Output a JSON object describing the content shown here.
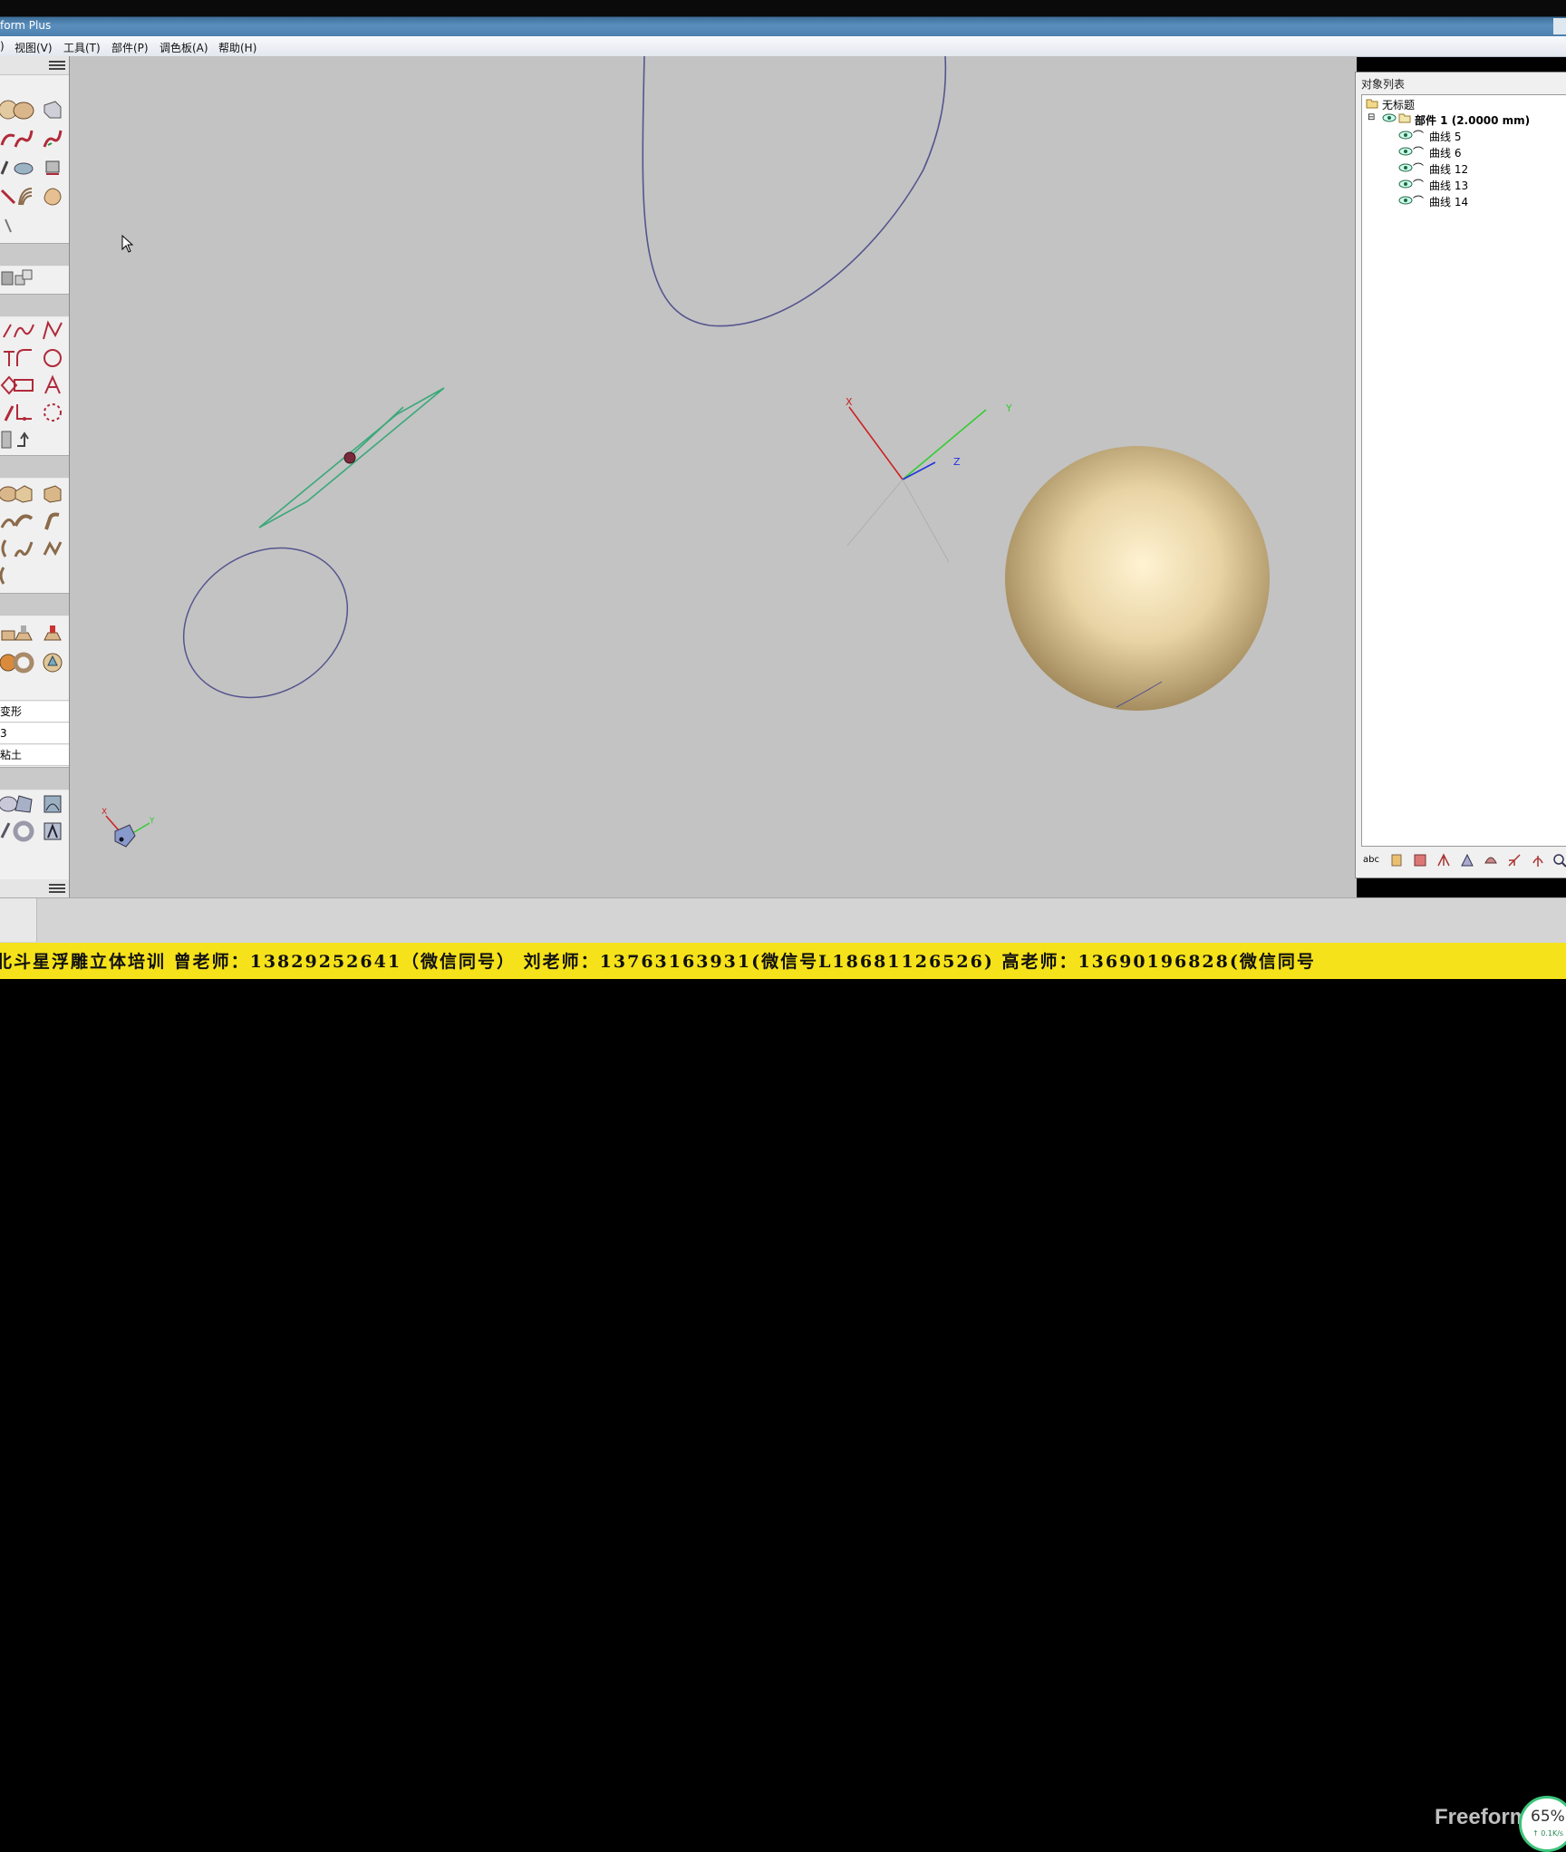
{
  "window": {
    "title": "form Plus"
  },
  "menu": [
    {
      "label": "视图(V)"
    },
    {
      "label": "工具(T)"
    },
    {
      "label": "部件(P)"
    },
    {
      "label": "调色板(A)"
    },
    {
      "label": "帮助(H)"
    }
  ],
  "left_panel": {
    "labels": [
      "变形",
      "3",
      "粘土"
    ]
  },
  "object_list": {
    "title": "对象列表",
    "root": "无标题",
    "part": "部件 1 (2.0000 mm)",
    "curves": [
      "曲线 5",
      "曲线 6",
      "曲线 12",
      "曲线 13",
      "曲线 14"
    ],
    "toolbar_text": "abc"
  },
  "viewport": {
    "axis_labels": {
      "x": "X",
      "y": "Y",
      "z": "Z"
    },
    "mini_axis": {
      "x": "X",
      "y": "Y"
    }
  },
  "ticker": {
    "text": "北斗星浮雕立体培训  曾老师：13829252641（微信同号）    刘老师：13763163931(微信号L18681126526)    高老师：13690196828(微信同号"
  },
  "overlay": {
    "watermark": "Freeform",
    "percent": "65%",
    "speed": "↑ 0.1K/s"
  },
  "colors": {
    "viewport_bg": "#c3c3c3",
    "curve": "#55558f",
    "plane": "#3aa87a",
    "sphere": "#f2dfb3",
    "ticker_bg": "#f5e21a"
  }
}
